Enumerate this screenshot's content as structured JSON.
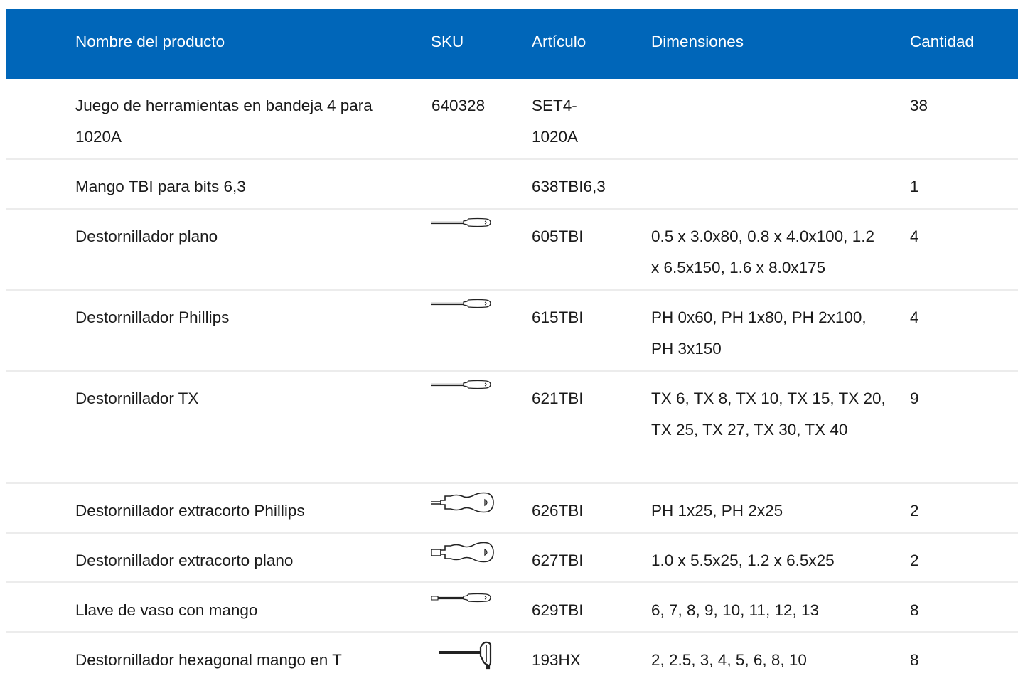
{
  "table": {
    "header": {
      "name": "Nombre del producto",
      "sku": "SKU",
      "article": "Artículo",
      "dimensions": "Dimensiones",
      "quantity": "Cantidad"
    },
    "rows": [
      {
        "name": "Juego de herramientas en bandeja 4 para 1020A",
        "sku": "640328",
        "article": "SET4-1020A",
        "dimensions": "",
        "quantity": "38"
      },
      {
        "name": "Mango TBI para bits 6,3",
        "sku": "",
        "article": "638TBI6,3",
        "dimensions": "",
        "quantity": "1"
      },
      {
        "name": "Destornillador plano",
        "sku_icon": "long-flat-screwdriver-icon",
        "article": "605TBI",
        "dimensions": "0.5 x 3.0x80, 0.8 x 4.0x100, 1.2 x 6.5x150, 1.6 x 8.0x175",
        "quantity": "4"
      },
      {
        "name": "Destornillador Phillips",
        "sku_icon": "long-phillips-screwdriver-icon",
        "article": "615TBI",
        "dimensions": "PH 0x60, PH 1x80, PH 2x100, PH 3x150",
        "quantity": "4"
      },
      {
        "name": "Destornillador TX",
        "sku_icon": "long-torx-screwdriver-icon",
        "article": "621TBI",
        "dimensions": "TX 6, TX 8, TX 10, TX 15, TX 20, TX 25, TX 27, TX 30, TX 40",
        "quantity": "9"
      },
      {
        "name": "Destornillador extracorto Phillips",
        "sku_icon": "stubby-phillips-screwdriver-icon",
        "article": "626TBI",
        "dimensions": "PH 1x25, PH 2x25",
        "quantity": "2"
      },
      {
        "name": "Destornillador extracorto plano",
        "sku_icon": "stubby-flat-screwdriver-icon",
        "article": "627TBI",
        "dimensions": "1.0 x 5.5x25, 1.2 x 6.5x25",
        "quantity": "2"
      },
      {
        "name": "Llave de vaso con mango",
        "sku_icon": "nut-driver-icon",
        "article": "629TBI",
        "dimensions": "6, 7, 8, 9, 10, 11, 12, 13",
        "quantity": "8"
      },
      {
        "name": "Destornillador hexagonal mango en T",
        "sku_icon": "t-handle-hex-key-icon",
        "article": "193HX",
        "dimensions": "2, 2.5, 3, 4, 5, 6, 8, 10",
        "quantity": "8"
      }
    ]
  }
}
